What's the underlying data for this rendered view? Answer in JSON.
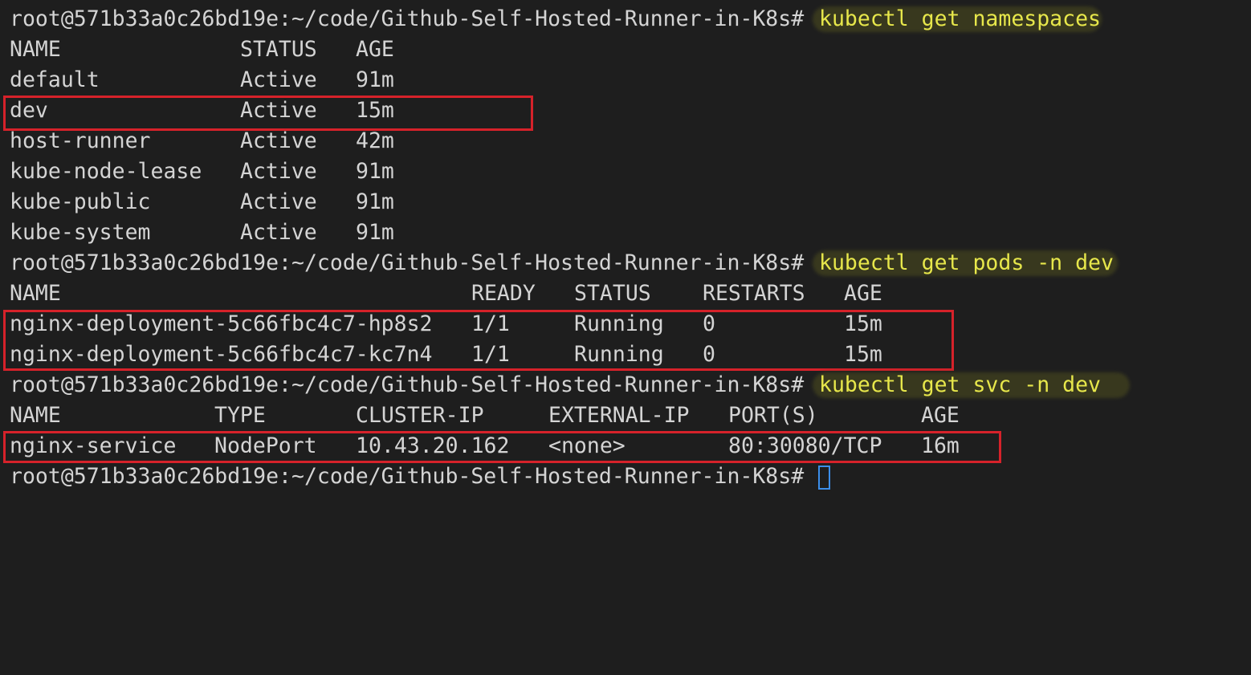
{
  "prompt": "root@571b33a0c26bd19e:~/code/Github-Self-Hosted-Runner-in-K8s#",
  "commands": {
    "namespaces": "kubectl get namespaces",
    "pods": "kubectl get pods -n dev",
    "svc": "kubectl get svc -n dev"
  },
  "namespaces": {
    "headers": [
      "NAME",
      "STATUS",
      "AGE"
    ],
    "rows": [
      [
        "default",
        "Active",
        "91m"
      ],
      [
        "dev",
        "Active",
        "15m"
      ],
      [
        "host-runner",
        "Active",
        "42m"
      ],
      [
        "kube-node-lease",
        "Active",
        "91m"
      ],
      [
        "kube-public",
        "Active",
        "91m"
      ],
      [
        "kube-system",
        "Active",
        "91m"
      ]
    ]
  },
  "pods": {
    "headers": [
      "NAME",
      "READY",
      "STATUS",
      "RESTARTS",
      "AGE"
    ],
    "rows": [
      [
        "nginx-deployment-5c66fbc4c7-hp8s2",
        "1/1",
        "Running",
        "0",
        "15m"
      ],
      [
        "nginx-deployment-5c66fbc4c7-kc7n4",
        "1/1",
        "Running",
        "0",
        "15m"
      ]
    ]
  },
  "svc": {
    "headers": [
      "NAME",
      "TYPE",
      "CLUSTER-IP",
      "EXTERNAL-IP",
      "PORT(S)",
      "AGE"
    ],
    "rows": [
      [
        "nginx-service",
        "NodePort",
        "10.43.20.162",
        "<none>",
        "80:30080/TCP",
        "16m"
      ]
    ]
  },
  "colors": {
    "background": "#1e1e1e",
    "text": "#d4d4d4",
    "command": "#e7e74b",
    "highlight_box": "#d6222a",
    "cursor": "#3b8eea"
  }
}
